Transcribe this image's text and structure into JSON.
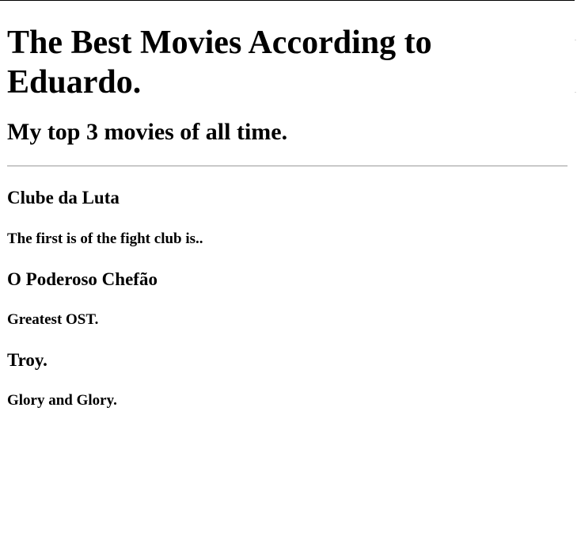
{
  "page": {
    "title": "The Best Movies According to Eduardo.",
    "subtitle": "My top 3 movies of all time."
  },
  "movies": [
    {
      "title": "Clube da Luta",
      "description": "The first is of the fight club is.."
    },
    {
      "title": "O Poderoso Chefão",
      "description": "Greatest OST."
    },
    {
      "title": "Troy.",
      "description": "Glory and Glory."
    }
  ]
}
